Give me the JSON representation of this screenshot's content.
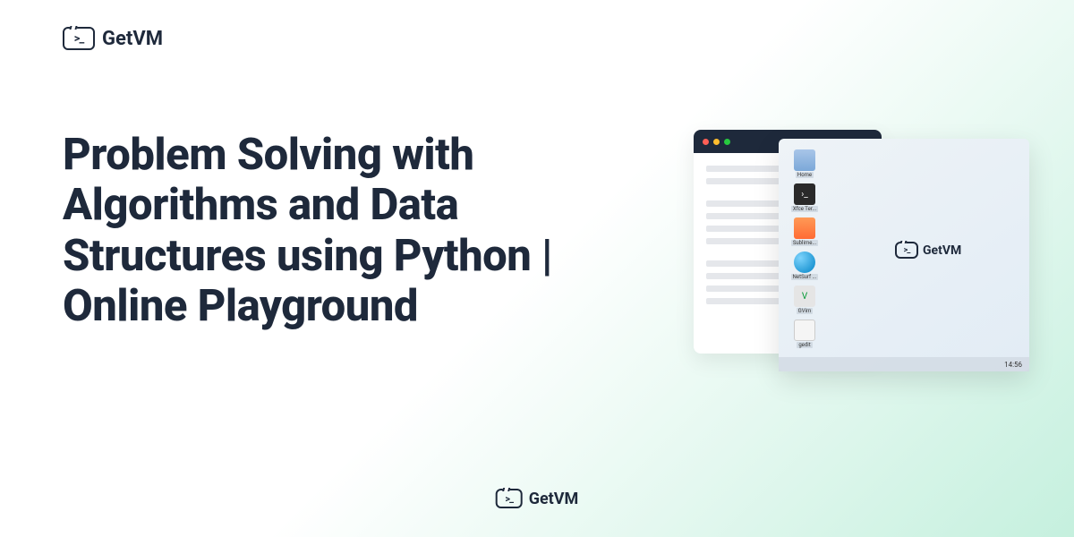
{
  "brand": {
    "name": "GetVM"
  },
  "page": {
    "title": "Problem Solving with Algorithms and Data Structures using Python | Online Playground"
  },
  "desktop": {
    "icons": [
      {
        "label": "Home"
      },
      {
        "label": "Xfce Ter..."
      },
      {
        "label": "Sublime..."
      },
      {
        "label": "NetSurf ..."
      },
      {
        "label": "GVim"
      },
      {
        "label": "gedit"
      }
    ],
    "clock": "14:56",
    "vm_label": "GetVM"
  }
}
